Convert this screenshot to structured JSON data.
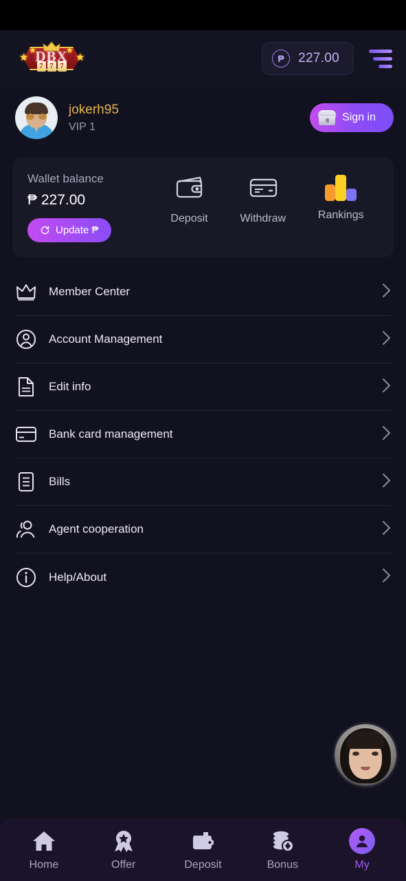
{
  "header": {
    "logo_main": "DBX",
    "logo_sevens": [
      "7",
      "7",
      "7"
    ],
    "balance_currency_symbol": "₱",
    "balance_amount": "227.00",
    "menu_icon": "hamburger-icon"
  },
  "profile": {
    "username": "jokerh95",
    "vip_level": "VIP 1",
    "signin_label": "Sign in",
    "avatar_icon": "user-avatar"
  },
  "wallet": {
    "label": "Wallet balance",
    "amount": "₱ 227.00",
    "update_label": "Update ₱",
    "actions": [
      {
        "label": "Deposit",
        "icon": "wallet-icon"
      },
      {
        "label": "Withdraw",
        "icon": "credit-card-icon"
      },
      {
        "label": "Rankings",
        "icon": "bar-chart-icon"
      }
    ]
  },
  "menu": {
    "items": [
      {
        "label": "Member Center",
        "icon": "crown-icon"
      },
      {
        "label": "Account Management",
        "icon": "user-circle-icon"
      },
      {
        "label": "Edit info",
        "icon": "document-icon"
      },
      {
        "label": "Bank card management",
        "icon": "card-icon"
      },
      {
        "label": "Bills",
        "icon": "list-document-icon"
      },
      {
        "label": "Agent cooperation",
        "icon": "people-icon"
      },
      {
        "label": "Help/About",
        "icon": "info-circle-icon"
      }
    ],
    "chevron": "chevron-right-icon"
  },
  "support": {
    "icon": "support-agent-avatar"
  },
  "bottom_nav": {
    "items": [
      {
        "label": "Home",
        "icon": "home-icon",
        "active": false
      },
      {
        "label": "Offer",
        "icon": "medal-icon",
        "active": false
      },
      {
        "label": "Deposit",
        "icon": "wallet-icon",
        "active": false
      },
      {
        "label": "Bonus",
        "icon": "coins-icon",
        "active": false
      },
      {
        "label": "My",
        "icon": "person-icon",
        "active": true
      }
    ]
  },
  "colors": {
    "page_bg": "#12111f",
    "card_bg": "#191827",
    "accent_purple": "#8c4cf5",
    "accent_magenta": "#c24bef",
    "gold": "#e3b44a",
    "nav_bg": "#1a1329"
  }
}
